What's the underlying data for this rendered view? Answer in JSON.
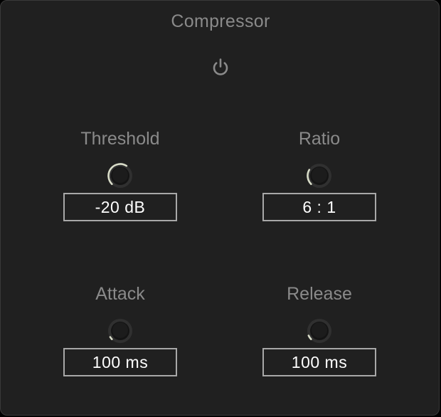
{
  "plugin": {
    "title": "Compressor",
    "power_icon": "power-icon",
    "accent_color": "#d8dcc8"
  },
  "params": {
    "threshold": {
      "label": "Threshold",
      "value": "-20 dB",
      "level": 0.62
    },
    "ratio": {
      "label": "Ratio",
      "value": "6 : 1",
      "level": 0.28
    },
    "attack": {
      "label": "Attack",
      "value": "100 ms",
      "level": 0.05
    },
    "release": {
      "label": "Release",
      "value": "100 ms",
      "level": 0.08
    }
  }
}
